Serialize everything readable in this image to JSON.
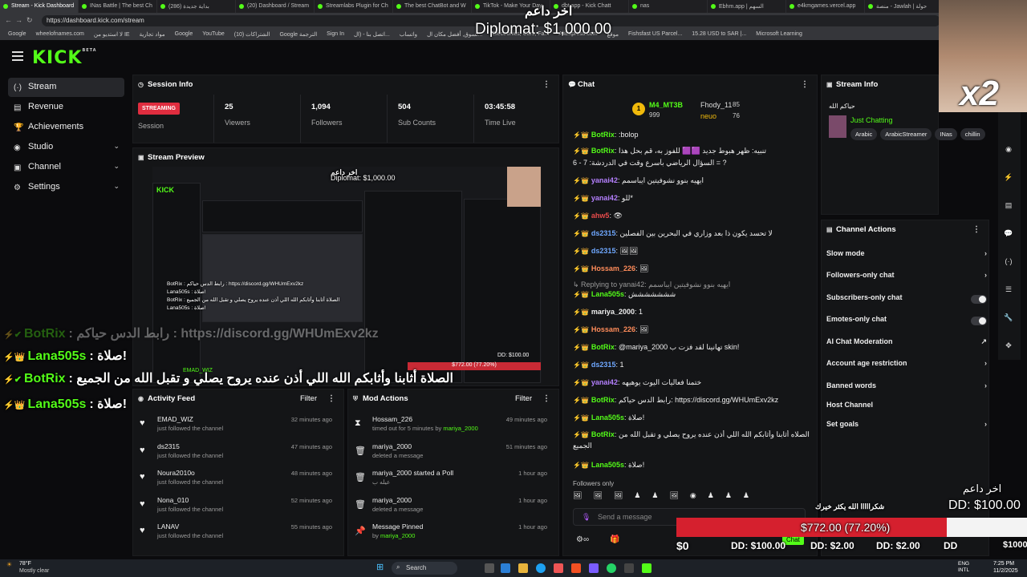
{
  "browser": {
    "tabs": [
      "Stream - Kick Dashboard",
      "INas Battle | The best Ch",
      "بداية جديدة (286)",
      "(20) Dashboard / Stream",
      "Streamlabs Plugin for Ch",
      "The best ChatBot and W",
      "TikTok - Make Your Day",
      "dbt.app - Kick Chatt",
      "nas",
      "Ebhm.app | السهم",
      "e4kmgames.vercel.app",
      "منصة - Jawlah | حولة"
    ],
    "url": "https://dashboard.kick.com/stream",
    "bookmarks": [
      "Google",
      "wheelofnames.com",
      "لا استديو من IE",
      "مواد تجارية",
      "Google",
      "YouTube",
      "الشتراكات (10)",
      "Google الترجمة",
      "Sign In",
      "اتصل بنا - (ال...",
      "واتساب",
      "تسوق, أفضل مكان ال...",
      "Electronics, Cars, Fa...",
      "AliExpress.com",
      "موقع",
      "Fishsfast US Parcel...",
      "15.28 USD to SAR |...",
      "Microsoft Learning"
    ]
  },
  "app": {
    "logo": "KICK",
    "logo_sup": "BETA",
    "nav": [
      {
        "label": "Stream",
        "icon": "(·)",
        "chev": ""
      },
      {
        "label": "Revenue",
        "icon": "▤",
        "chev": ""
      },
      {
        "label": "Achievements",
        "icon": "🏆",
        "chev": ""
      },
      {
        "label": "Studio",
        "icon": "◉",
        "chev": "⌄"
      },
      {
        "label": "Channel",
        "icon": "▣",
        "chev": "⌄"
      },
      {
        "label": "Settings",
        "icon": "⚙",
        "chev": "⌄"
      }
    ]
  },
  "session": {
    "title": "Session Info",
    "status": "STREAMING",
    "status_label": "Session",
    "stats": [
      {
        "value": "25",
        "label": "Viewers"
      },
      {
        "value": "1,094",
        "label": "Followers"
      },
      {
        "value": "504",
        "label": "Sub Counts"
      },
      {
        "value": "03:45:58",
        "label": "Time Live"
      }
    ]
  },
  "preview": {
    "title": "Stream Preview",
    "overlay_top": "اخر داعم",
    "overlay_amount": "Diplomat: $1,000.00",
    "overlay_lines": [
      "BotRix : رابط الدس حياكم : https://discord.gg/WHUmExv2kz",
      "Lana505s : صلاة!",
      "BotRix : الصلاة أثابنا وأثابكم الله اللي أذن عنده يروح يصلي و تقبل الله من الجميع",
      "Lana505s : صلاة!"
    ],
    "mini_bar": "$772.00 (77.20%)",
    "mini_dd": "DD: $100.00",
    "mini_name": "EMAD_WIZ"
  },
  "activity": {
    "title": "Activity Feed",
    "filter": "Filter",
    "items": [
      {
        "name": "EMAD_WIZ",
        "sub": "just followed the channel",
        "time": "32 minutes ago"
      },
      {
        "name": "ds2315",
        "sub": "just followed the channel",
        "time": "47 minutes ago"
      },
      {
        "name": "Noura2010o",
        "sub": "just followed the channel",
        "time": "48 minutes ago"
      },
      {
        "name": "Nona_010",
        "sub": "just followed the channel",
        "time": "52 minutes ago"
      },
      {
        "name": "LANAV",
        "sub": "just followed the channel",
        "time": "55 minutes ago"
      }
    ]
  },
  "mod": {
    "title": "Mod Actions",
    "filter": "Filter",
    "items": [
      {
        "icon": "⧗",
        "title": "Hossam_226",
        "sub_pre": "timed out for 5 minutes by ",
        "sub_user": "mariya_2000",
        "time": "49 minutes ago"
      },
      {
        "icon": "🗑",
        "title": "mariya_2000",
        "sub_pre": "deleted a message",
        "sub_user": "",
        "time": "51 minutes ago"
      },
      {
        "icon": "🗑",
        "title": "mariya_2000 started a Poll",
        "sub_pre": "عيله ب",
        "sub_user": "",
        "time": "1 hour ago"
      },
      {
        "icon": "🗑",
        "title": "mariya_2000",
        "sub_pre": "deleted a message",
        "sub_user": "",
        "time": "1 hour ago"
      },
      {
        "icon": "📌",
        "title": "Message Pinned",
        "sub_pre": "by ",
        "sub_user": "mariya_2000",
        "time": "1 hour ago"
      }
    ]
  },
  "chat": {
    "title": "Chat",
    "top_left_name": "M4_MT3B",
    "top_left_val": "999",
    "top_right_name": "Fhody_11",
    "top_right_val": "85",
    "top_right2_name": "neuo",
    "top_right2_val": "76",
    "messages": [
      {
        "user": "BotRix",
        "color": "#53fc18",
        "text": ":bolop"
      },
      {
        "user": "BotRix",
        "color": "#53fc18",
        "text": "تنبيه: ظهر هبوط جديد 🟪🟪 للفوز به، قم بحل هذا"
      },
      {
        "user": "",
        "color": "#eee",
        "text": "السؤال الرياضي بأسرع وقت في الدردشة: 7 - 6 = ?"
      },
      {
        "user": "yanai42",
        "color": "#b580ff",
        "text": "ايهيه بنوو نشوفيتين ايباسمم"
      },
      {
        "user": "yanai42",
        "color": "#b580ff",
        "text": "للو*"
      },
      {
        "user": "ahw5",
        "color": "#e84b4b",
        "text": "👁"
      },
      {
        "user": "ds2315",
        "color": "#6fa8ff",
        "text": "لا تحسد يكون ذا بعد وزاري في البحرين بين الفصلين"
      },
      {
        "user": "ds2315",
        "color": "#6fa8ff",
        "text": "🖼🖼"
      },
      {
        "user": "Hossam_226",
        "color": "#ff8c5a",
        "text": "🖼"
      },
      {
        "user": "",
        "color": "#999",
        "text": "↳ Replying to yanai42: ايهيه بنوو نشوفيتين ايباسمم"
      },
      {
        "user": "Lana505s",
        "color": "#53fc18",
        "text": "ششششششش"
      },
      {
        "user": "mariya_2000",
        "color": "#eee",
        "text": "1"
      },
      {
        "user": "Hossam_226",
        "color": "#ff8c5a",
        "text": "🖼"
      },
      {
        "user": "BotRix",
        "color": "#53fc18",
        "text": "@mariya_2000 تهانينا لقد فزت ب skin!"
      },
      {
        "user": "ds2315",
        "color": "#6fa8ff",
        "text": "1"
      },
      {
        "user": "yanai42",
        "color": "#b580ff",
        "text": "ختمنا فعاليات اليوت يوهيهه"
      },
      {
        "user": "BotRix",
        "color": "#53fc18",
        "text": "رابط الدس حياكم: https://discord.gg/WHUmExv2kz"
      },
      {
        "user": "Lana505s",
        "color": "#53fc18",
        "text": "صلاة!"
      },
      {
        "user": "BotRix",
        "color": "#53fc18",
        "text": "الصلاه أثابنا وأثابكم الله اللي أذن عنده يروح يصلي و تقبل الله من"
      },
      {
        "user": "",
        "color": "#eee",
        "text": "الجميع"
      },
      {
        "user": "Lana505s",
        "color": "#53fc18",
        "text": "صلاة!"
      }
    ],
    "followers_only": "Followers only",
    "placeholder": "Send a message",
    "chat_btn": "Chat"
  },
  "streaminfo": {
    "title": "Stream Info",
    "channel_title": "حياكم الله",
    "category": "Just Chatting",
    "tags": [
      "Arabic",
      "ArabicStreamer",
      "INas",
      "chillin"
    ]
  },
  "actions": {
    "title": "Channel Actions",
    "rows": [
      {
        "label": "Slow mode",
        "kind": "chev"
      },
      {
        "label": "Followers-only chat",
        "kind": "chev"
      },
      {
        "label": "Subscribers-only chat",
        "kind": "toggle"
      },
      {
        "label": "Emotes-only chat",
        "kind": "toggle"
      },
      {
        "label": "AI Chat Moderation",
        "kind": "ext"
      },
      {
        "label": "Account age restriction",
        "kind": "chev"
      },
      {
        "label": "Banned words",
        "kind": "chev"
      },
      {
        "label": "Host Channel",
        "kind": "none"
      },
      {
        "label": "Set goals",
        "kind": "chev"
      }
    ]
  },
  "overlay": {
    "top_label": "اخر داعم",
    "top_amount": "Diplomat: $1,000.00",
    "multiplier": "x2",
    "left_lines": [
      {
        "user": "BotRix",
        "text": ": رابط الدس حياكم : https://discord.gg/WHUmExv2kz"
      },
      {
        "user": "Lana505s",
        "text": ": صلاة!"
      },
      {
        "user": "BotRix",
        "text": ": الصلاة أثابنا وأثابكم الله اللي أذن عنده يروح يصلي و تقبل الله من الجميع"
      },
      {
        "user": "Lana505s",
        "text": ": صلاة!"
      }
    ],
    "br_label": "اخر داعم",
    "br_amount": "DD: $100.00",
    "thanks": "شكرااااا الله يكثر خيرك",
    "goal_text": "$772.00 (77.20%)",
    "goal_fraction": 0.772,
    "goal_start": "$0",
    "goal_end": "$1000",
    "dd_items": [
      "DD: $100.00",
      "DD: $2.00",
      "DD: $2.00",
      "DD"
    ]
  },
  "taskbar": {
    "weather_temp": "78°F",
    "weather_desc": "Mostly clear",
    "search": "Search",
    "lang1": "ENG",
    "lang2": "INTL",
    "time": "7:25 PM",
    "date": "11/2/2025"
  }
}
